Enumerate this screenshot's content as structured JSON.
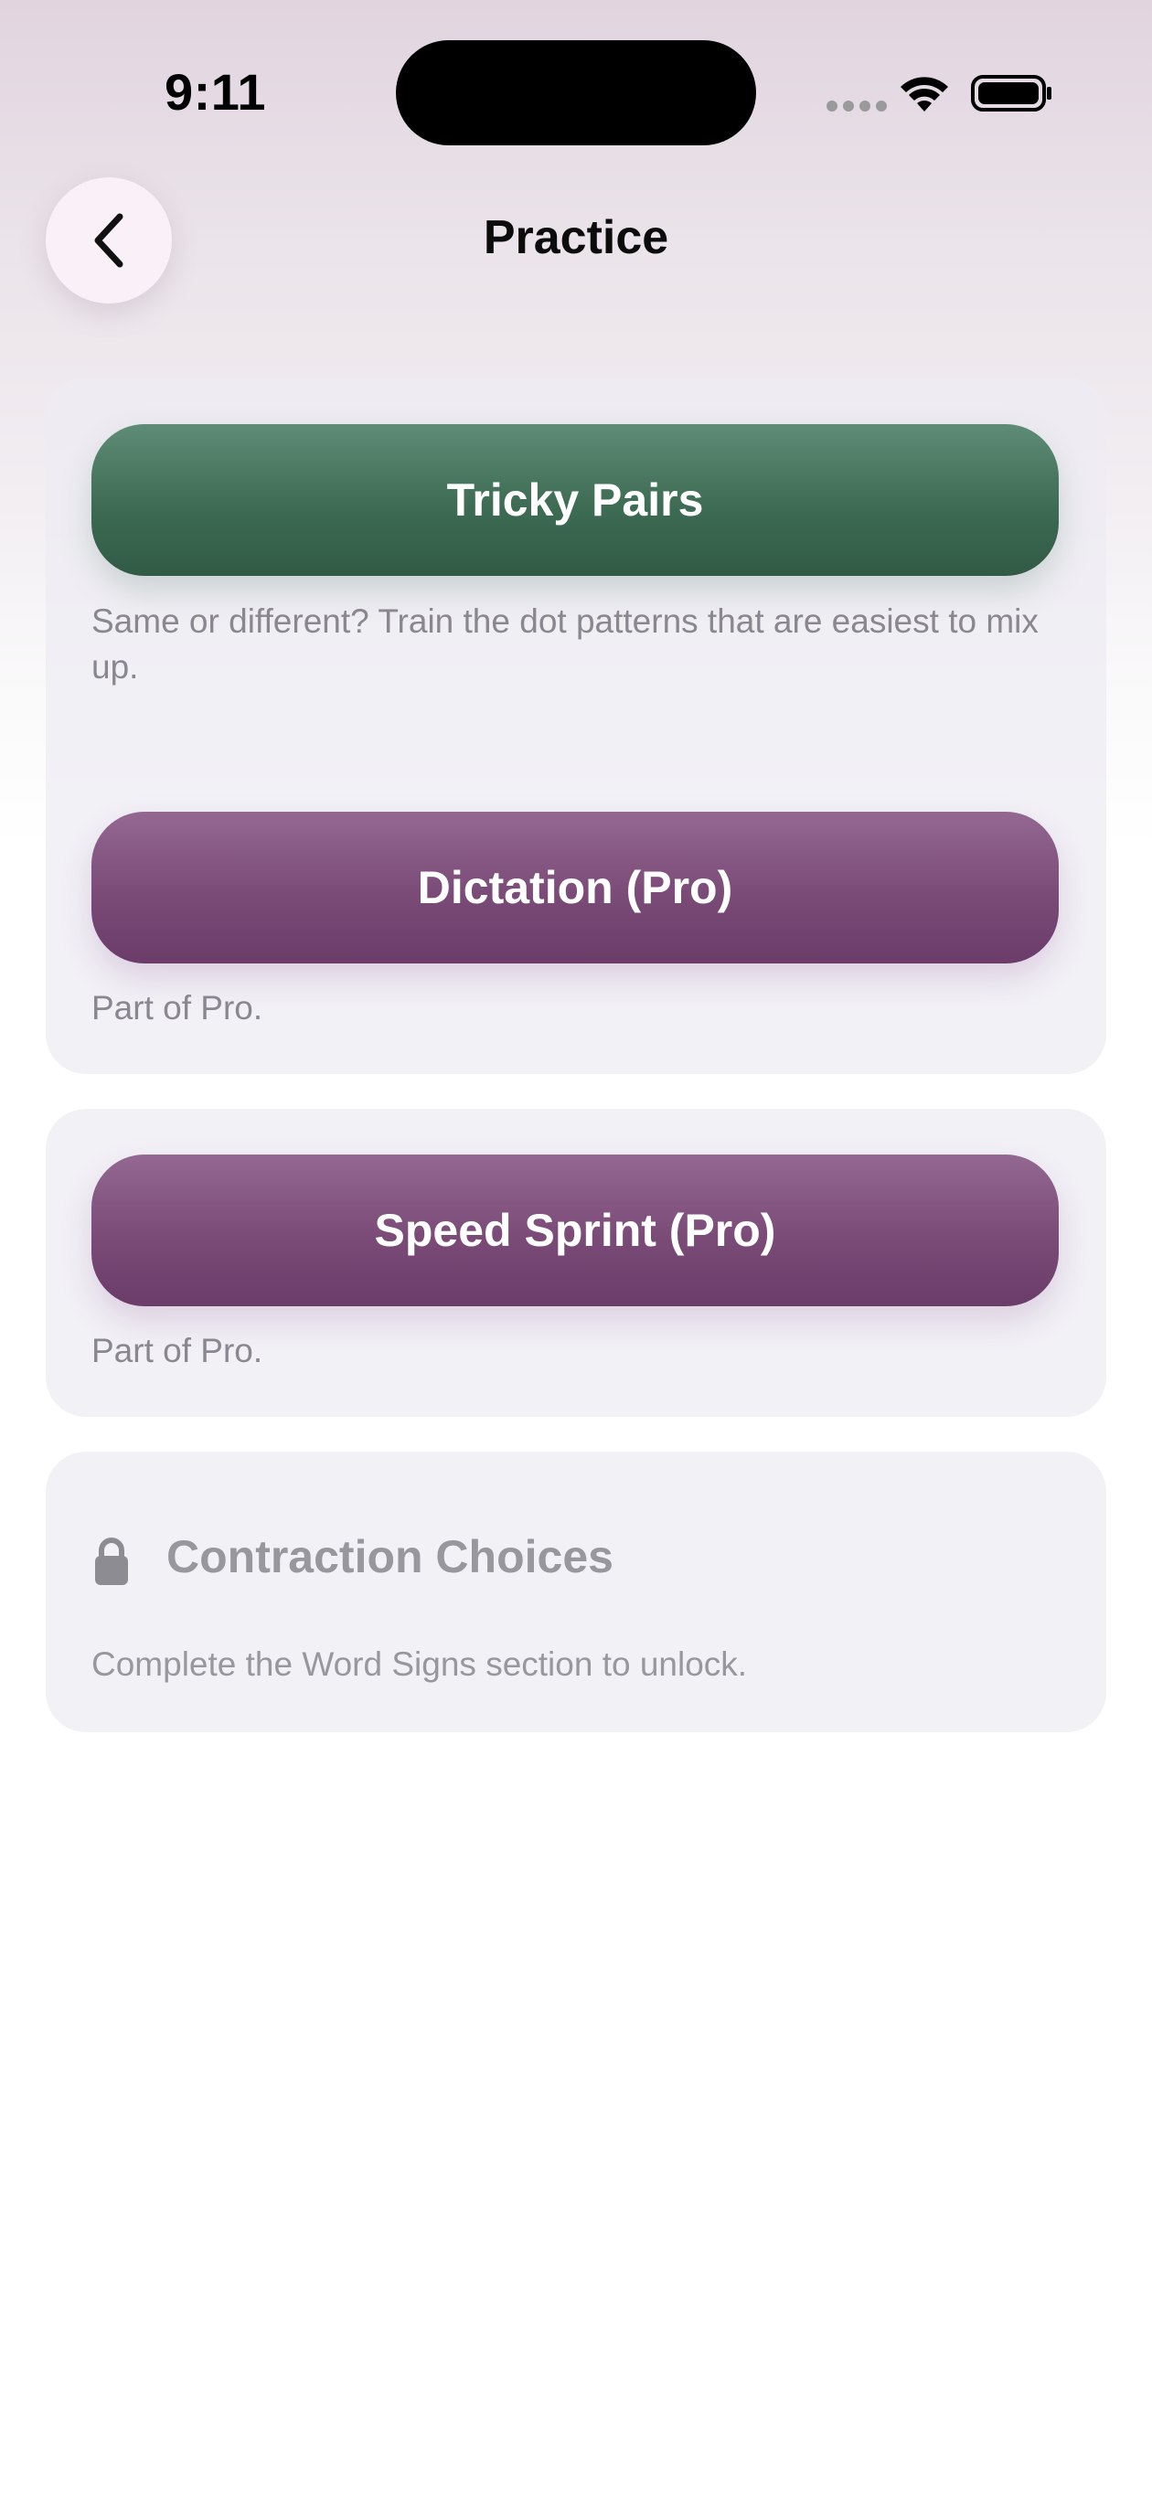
{
  "status_bar": {
    "time": "9:11",
    "icons": [
      "cellular-dots-icon",
      "wifi-icon",
      "battery-icon"
    ]
  },
  "header": {
    "back_icon": "chevron-left-icon",
    "title": "Practice"
  },
  "sections": [
    {
      "button_label": "Tricky Pairs",
      "description": "Same or different? Train the dot patterns that are easiest to mix up.",
      "color": "#3d6b53"
    },
    {
      "button_label": "Dictation (Pro)",
      "description": "Part of Pro.",
      "color": "#7a4b77"
    },
    {
      "button_label": "Speed Sprint (Pro)",
      "description": "Part of Pro.",
      "color": "#7a4b77"
    }
  ],
  "locked_section": {
    "icon": "lock-icon",
    "title": "Contraction Choices",
    "description": "Complete the Word Signs section to unlock."
  }
}
